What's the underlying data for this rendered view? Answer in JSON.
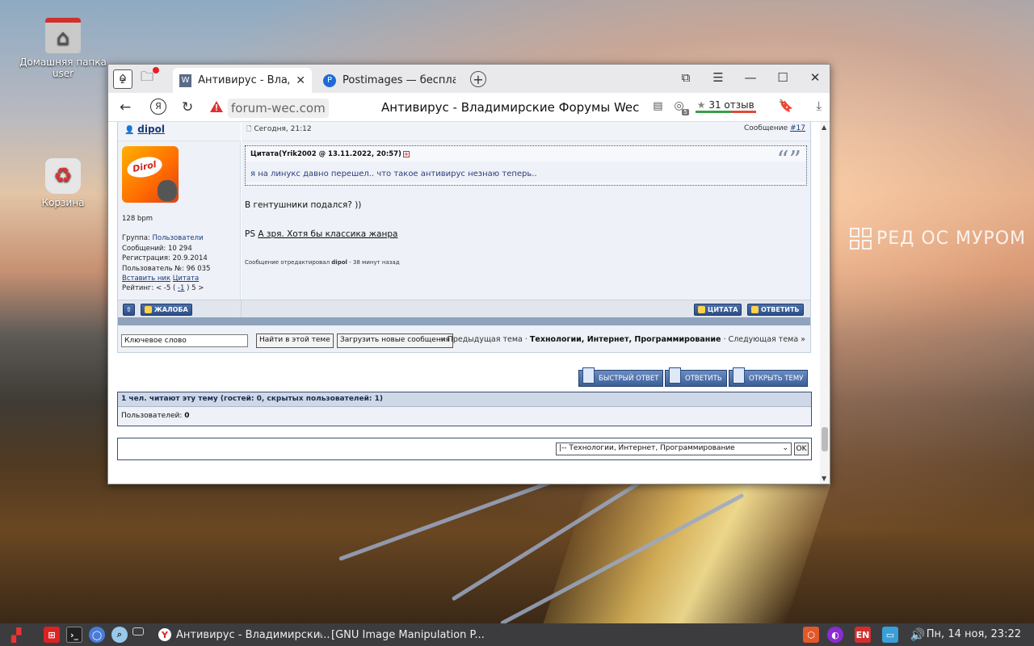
{
  "desktop": {
    "icons": [
      {
        "label": "Домашняя папка user"
      },
      {
        "label": "Корзина"
      }
    ],
    "watermark": "РЕД ОС МУРОМ"
  },
  "browser": {
    "tab_counter": "2",
    "tabs": [
      {
        "title": "Антивирус - Владимир",
        "favicon": "W"
      },
      {
        "title": "Postimages — бесплатны",
        "favicon": "P"
      }
    ],
    "url": "forum-wec.com",
    "page_title": "Антивирус - Владимирские Форумы Wec",
    "reviews": "31 отзыв",
    "ya_badge": "5"
  },
  "post": {
    "author": "dipol",
    "date": "Сегодня, 21:12",
    "msg_label": "Сообщение",
    "msg_no": "#17",
    "profile": {
      "status": "128 bpm",
      "group_label": "Группа:",
      "group": "Пользователи",
      "messages": "Сообщений: 10 294",
      "registered": "Регистрация: 20.9.2014",
      "user_no": "Пользователь №: 96 035",
      "insert_nick": "Вставить ник",
      "quote_link": "Цитата",
      "rating": "Рейтинг: < -5 (",
      "rating_val": "-1",
      "rating_end": ") 5 >"
    },
    "quote_header": "Цитата(Yrik2002 @ 13.11.2022, 20:57)",
    "quote_text": "я на линукс давно перешел.. что такое антивирус незнаю теперь..",
    "body_line1": "В гентушники подался? ))",
    "body_ps": "PS",
    "body_link": "А зря. Хотя бы классика жанра",
    "edited_prefix": "Сообщение отредактировал",
    "edited_user": "dipol",
    "edited_suffix": "- 38 минут назад",
    "btn_complaint": "ЖАЛОБА",
    "btn_quote": "ЦИТАТА",
    "btn_reply": "ОТВЕТИТЬ"
  },
  "search": {
    "keyword": "Ключевое слово",
    "find_btn": "Найти в этой теме",
    "load_btn": "Загрузить новые сообщения",
    "prev": "« Предыдущая тема ·",
    "category": "Технологии, Интернет, Программирование",
    "next": "· Следующая тема »"
  },
  "actions": {
    "quick_reply": "БЫСТРЫЙ ОТВЕТ",
    "reply": "ОТВЕТИТЬ",
    "open_topic": "ОТКРЫТЬ ТЕМУ"
  },
  "readers": {
    "header": "1 чел. читают эту тему (гостей: 0, скрытых пользователей: 1)",
    "users_label": "Пользователей:",
    "users_count": "0"
  },
  "jump": {
    "selected": "|-- Технологии, Интернет, Программирование",
    "ok": "OK"
  },
  "taskbar": {
    "items": [
      {
        "label": "Антивирус - Владимирски..."
      },
      {
        "label": "[GNU Image Manipulation P..."
      }
    ],
    "lang": "EN",
    "clock": "Пн, 14 ноя, 23:22"
  }
}
